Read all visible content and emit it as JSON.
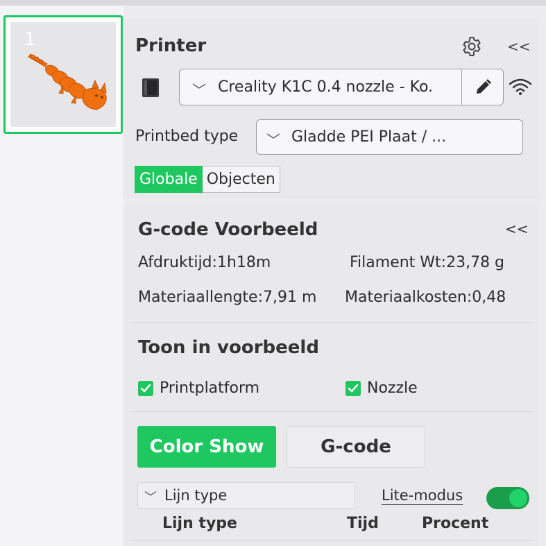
{
  "plate": {
    "number": "1"
  },
  "printer": {
    "title": "Printer",
    "selected_printer": "Creality K1C 0.4 nozzle - Ko.",
    "printbed_label": "Printbed type",
    "printbed_value": "Gladde PEI Plaat / ...",
    "tabs": [
      "Globale",
      "Objecten"
    ],
    "collapse": "<<"
  },
  "gcode": {
    "title": "G-code Voorbeeld",
    "collapse": "<<",
    "print_time": "Afdruktijd:1h18m",
    "filament_weight": "Filament Wt:23,78 g",
    "material_length": "Materiaallengte:7,91 m",
    "material_cost": "Materiaalkosten:0,48",
    "show_title": "Toon in voorbeeld",
    "check_platform": "Printplatform",
    "check_nozzle": "Nozzle",
    "btn_color_show": "Color Show",
    "btn_gcode": "G-code",
    "line_type_select": "Lijn type",
    "lite_mode": "Lite-modus",
    "col_line_type": "Lijn type",
    "col_time": "Tijd",
    "col_percent": "Procent"
  },
  "colors": {
    "accent": "#1ec760",
    "model": "#f07010"
  }
}
